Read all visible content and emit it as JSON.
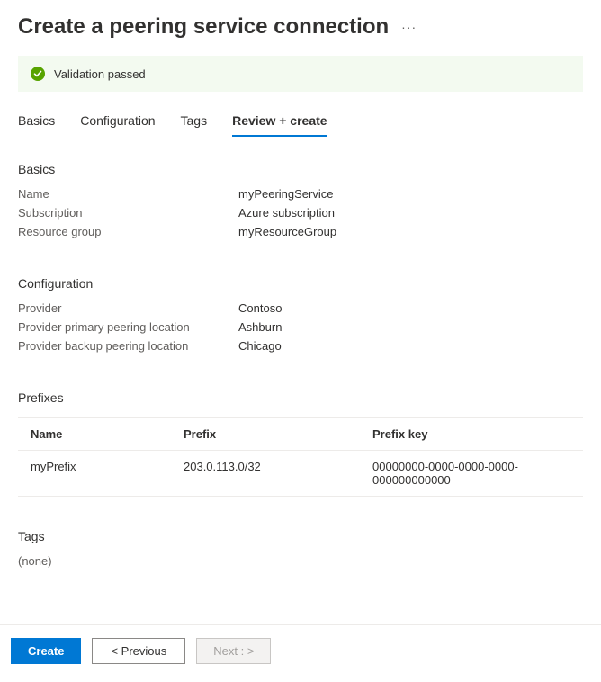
{
  "header": {
    "title": "Create a peering service connection"
  },
  "validation": {
    "message": "Validation passed"
  },
  "tabs": [
    {
      "label": "Basics"
    },
    {
      "label": "Configuration"
    },
    {
      "label": "Tags"
    },
    {
      "label": "Review + create"
    }
  ],
  "basics": {
    "title": "Basics",
    "rows": [
      {
        "label": "Name",
        "value": "myPeeringService"
      },
      {
        "label": "Subscription",
        "value": "Azure subscription"
      },
      {
        "label": "Resource group",
        "value": "myResourceGroup"
      }
    ]
  },
  "configuration": {
    "title": "Configuration",
    "rows": [
      {
        "label": "Provider",
        "value": "Contoso"
      },
      {
        "label": "Provider primary peering location",
        "value": "Ashburn"
      },
      {
        "label": "Provider backup peering location",
        "value": "Chicago"
      }
    ]
  },
  "prefixes": {
    "title": "Prefixes",
    "columns": {
      "name": "Name",
      "prefix": "Prefix",
      "key": "Prefix key"
    },
    "rows": [
      {
        "name": "myPrefix",
        "prefix": "203.0.113.0/32",
        "key": "00000000-0000-0000-0000-000000000000"
      }
    ]
  },
  "tagsSection": {
    "title": "Tags",
    "none": "(none)"
  },
  "footer": {
    "create": "Create",
    "previous": "< Previous",
    "next": "Next : >"
  }
}
